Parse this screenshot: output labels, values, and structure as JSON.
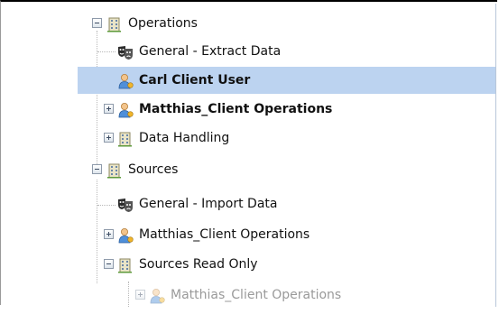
{
  "tree": {
    "nodes": [
      {
        "label": "Operations",
        "icon": "building-icon",
        "toggle": "minus"
      },
      {
        "label": "General - Extract Data",
        "icon": "theater-masks-icon",
        "toggle": ""
      },
      {
        "label": "Carl Client User",
        "icon": "user-icon",
        "toggle": "",
        "selected": true,
        "bold": true
      },
      {
        "label": "Matthias_Client Operations",
        "icon": "user-icon",
        "toggle": "plus",
        "bold": true
      },
      {
        "label": "Data Handling",
        "icon": "building-icon",
        "toggle": "plus"
      },
      {
        "label": "Sources",
        "icon": "building-icon",
        "toggle": "minus"
      },
      {
        "label": "General - Import Data",
        "icon": "theater-masks-icon",
        "toggle": ""
      },
      {
        "label": "Matthias_Client Operations",
        "icon": "user-icon",
        "toggle": "plus"
      },
      {
        "label": "Sources Read Only",
        "icon": "building-icon",
        "toggle": "minus"
      },
      {
        "label": "Matthias_Client Operations",
        "icon": "user-icon",
        "toggle": "plus",
        "faded": true
      }
    ]
  },
  "colors": {
    "selection": "#bcd3f0",
    "faded_text": "#9a9a9a"
  }
}
